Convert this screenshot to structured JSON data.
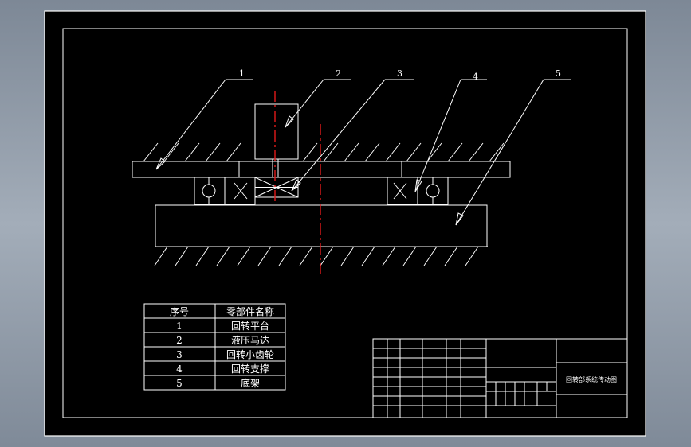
{
  "drawing": {
    "callouts": [
      "1",
      "2",
      "3",
      "4",
      "5"
    ],
    "parts_table": {
      "headers": [
        "序号",
        "零部件名称"
      ],
      "rows": [
        [
          "1",
          "回转平台"
        ],
        [
          "2",
          "液压马达"
        ],
        [
          "3",
          "回转小齿轮"
        ],
        [
          "4",
          "回转支撑"
        ],
        [
          "5",
          "底架"
        ]
      ]
    },
    "title_block": {
      "drawing_title": "回转部系统传动图"
    }
  },
  "colors": {
    "background": "#000000",
    "lines": "#ffffff",
    "center_lines": "#e21b1b",
    "viewport_gradient": "#a3adb9"
  }
}
